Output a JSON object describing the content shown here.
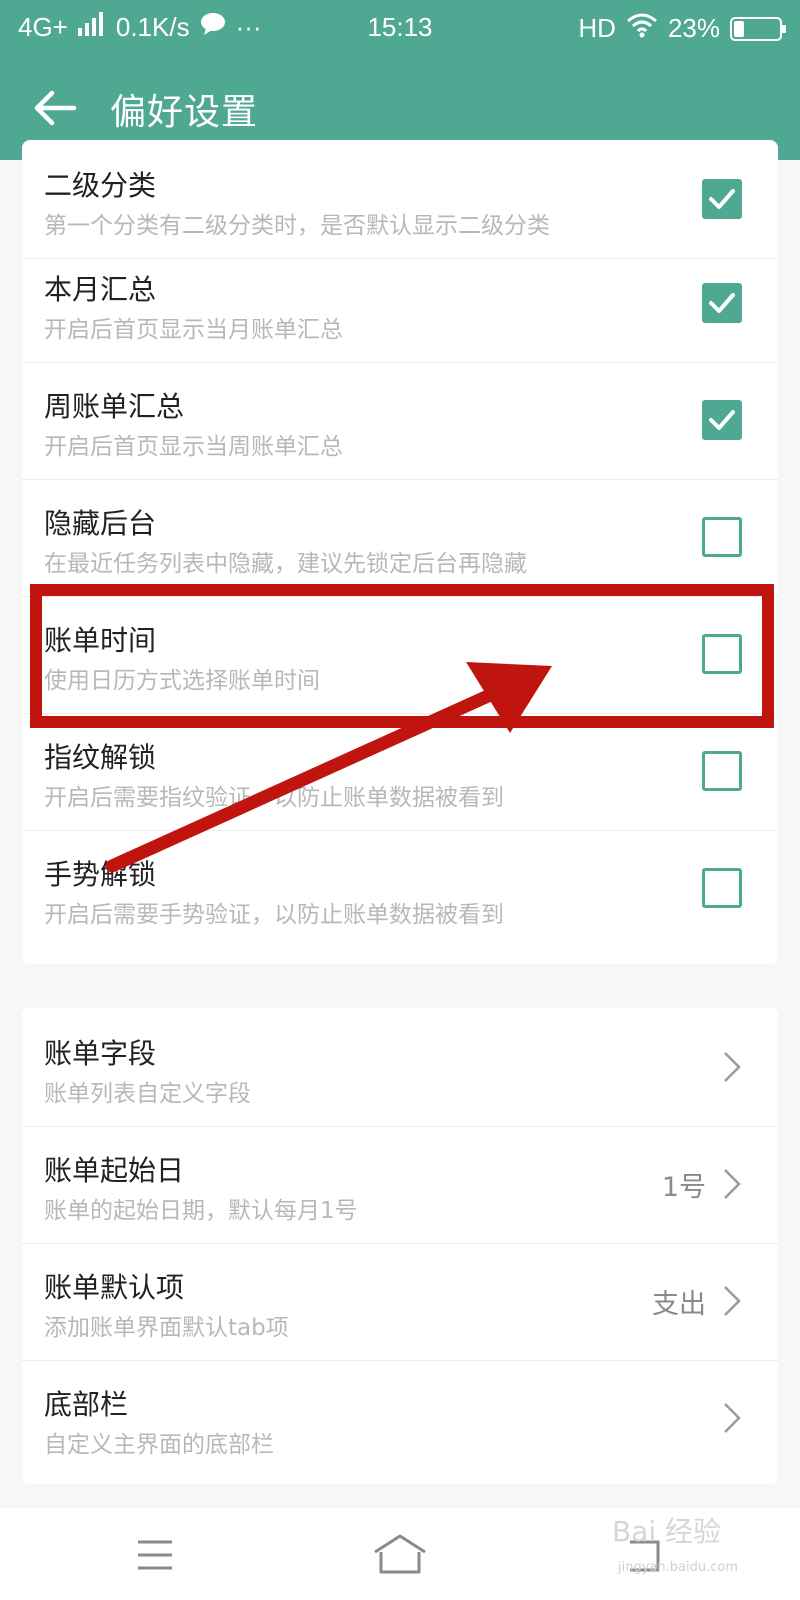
{
  "status_bar": {
    "network": "4G+",
    "speed": "0.1K/s",
    "time": "15:13",
    "hd": "HD",
    "battery": "23%",
    "battery_level": 0.23
  },
  "app_bar": {
    "title": "偏好设置"
  },
  "toggles": [
    {
      "title": "二级分类",
      "subtitle": "第一个分类有二级分类时，是否默认显示二级分类",
      "checked": true
    },
    {
      "title": "本月汇总",
      "subtitle": "开启后首页显示当月账单汇总",
      "checked": true
    },
    {
      "title": "周账单汇总",
      "subtitle": "开启后首页显示当周账单汇总",
      "checked": true
    },
    {
      "title": "隐藏后台",
      "subtitle": "在最近任务列表中隐藏，建议先锁定后台再隐藏",
      "checked": false
    },
    {
      "title": "账单时间",
      "subtitle": "使用日历方式选择账单时间",
      "checked": false
    },
    {
      "title": "指纹解锁",
      "subtitle": "开启后需要指纹验证，以防止账单数据被看到",
      "checked": false
    },
    {
      "title": "手势解锁",
      "subtitle": "开启后需要手势验证，以防止账单数据被看到",
      "checked": false
    }
  ],
  "links": [
    {
      "title": "账单字段",
      "subtitle": "账单列表自定义字段",
      "value": ""
    },
    {
      "title": "账单起始日",
      "subtitle": "账单的起始日期，默认每月1号",
      "value": "1号"
    },
    {
      "title": "账单默认项",
      "subtitle": "添加账单界面默认tab项",
      "value": "支出"
    },
    {
      "title": "底部栏",
      "subtitle": "自定义主界面的底部栏",
      "value": ""
    }
  ],
  "watermark": {
    "text": "Bai 经验",
    "url": "jingyan.baidu.com"
  },
  "colors": {
    "accent": "#4fa891",
    "annotation": "#c0140f"
  }
}
